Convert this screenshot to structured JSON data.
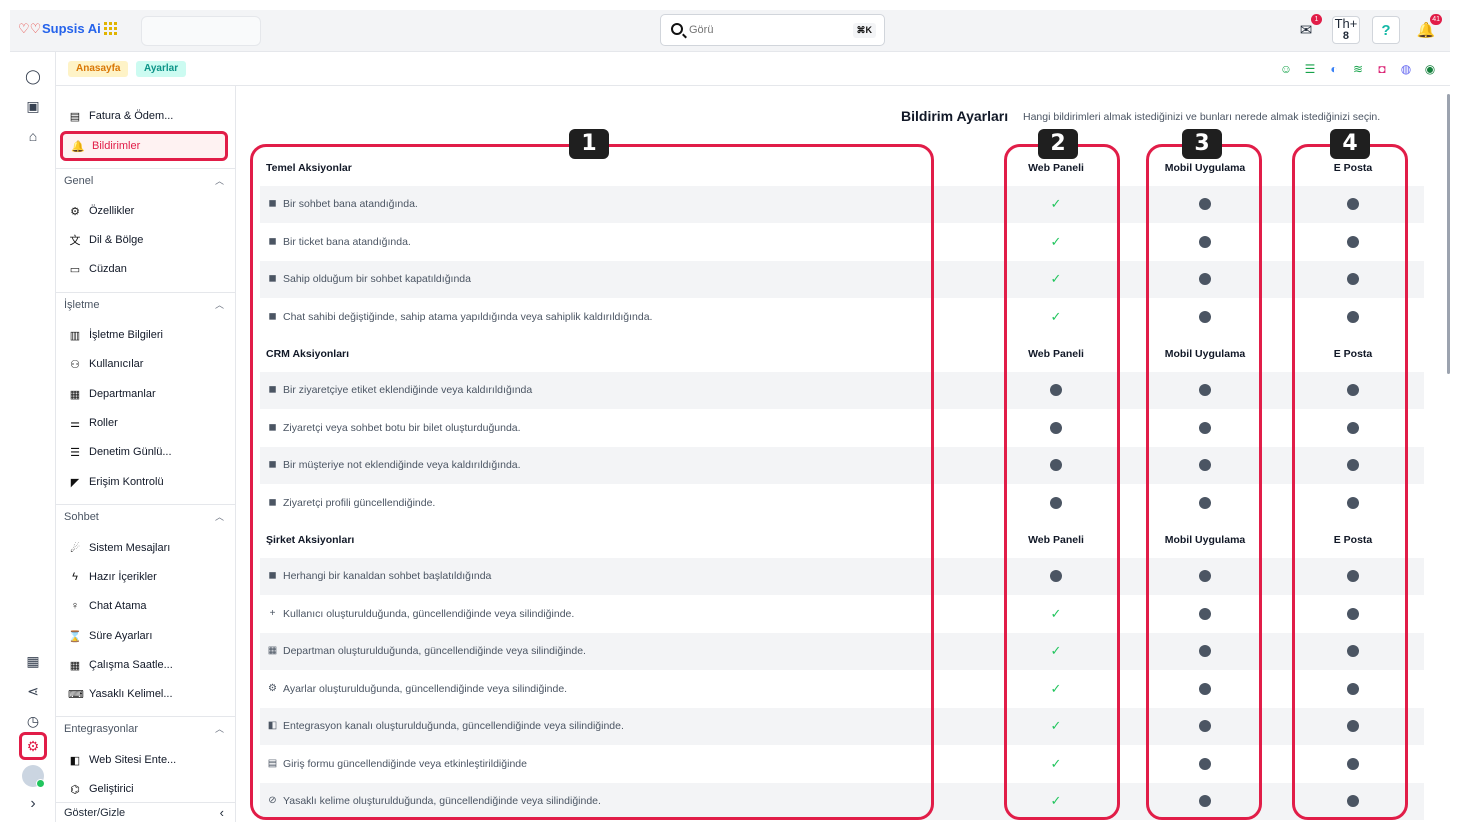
{
  "app": {
    "name": "Supsis Ai"
  },
  "search": {
    "placeholder": "Görü",
    "shortcut": "⌘K"
  },
  "top_icons": [
    {
      "icon": "mail-icon",
      "badge": "1"
    },
    {
      "icon": "workspace-icon",
      "label": "Th",
      "sub": "8"
    },
    {
      "icon": "help-icon"
    },
    {
      "icon": "bell-icon",
      "badge": "41"
    }
  ],
  "breadcrumb": {
    "home": "Anasayfa",
    "current": "Ayarlar"
  },
  "sidebar": {
    "top_items": [
      {
        "label": "Fatura & Ödem...",
        "icon": "billing-icon"
      },
      {
        "label": "Bildirimler",
        "icon": "bell-icon"
      }
    ],
    "sections": [
      {
        "title": "Genel",
        "items": [
          "Özellikler",
          "Dil & Bölge",
          "Cüzdan"
        ]
      },
      {
        "title": "İşletme",
        "items": [
          "İşletme Bilgileri",
          "Kullanıcılar",
          "Departmanlar",
          "Roller",
          "Denetim Günlü...",
          "Erişim Kontrolü"
        ]
      },
      {
        "title": "Sohbet",
        "items": [
          "Sistem Mesajları",
          "Hazır İçerikler",
          "Chat Atama",
          "Süre Ayarları",
          "Çalışma Saatle...",
          "Yasaklı Kelimel..."
        ]
      },
      {
        "title": "Entegrasyonlar",
        "items": [
          "Web Sitesi Ente...",
          "Geliştirici"
        ]
      }
    ],
    "footer": "Göster/Gizle"
  },
  "page": {
    "title": "Bildirim Ayarları",
    "description": "Hangi bildirimleri almak istediğinizi ve bunları nerede almak istediğinizi seçin."
  },
  "columns": {
    "web": "Web Paneli",
    "mobile": "Mobil Uygulama",
    "email": "E Posta"
  },
  "groups": [
    {
      "title": "Temel Aksiyonlar",
      "rows": [
        {
          "text": "Bir sohbet bana atandığında.",
          "web": true,
          "mobile": false,
          "email": false
        },
        {
          "text": "Bir ticket bana atandığında.",
          "web": true,
          "mobile": false,
          "email": false
        },
        {
          "text": "Sahip olduğum bir sohbet kapatıldığında",
          "web": true,
          "mobile": false,
          "email": false
        },
        {
          "text": "Chat sahibi değiştiğinde, sahip atama yapıldığında veya sahiplik kaldırıldığında.",
          "web": true,
          "mobile": false,
          "email": false
        }
      ]
    },
    {
      "title": "CRM Aksiyonları",
      "rows": [
        {
          "text": "Bir ziyaretçiye etiket eklendiğinde veya kaldırıldığında",
          "web": false,
          "mobile": false,
          "email": false
        },
        {
          "text": "Ziyaretçi veya sohbet botu bir bilet oluşturduğunda.",
          "web": false,
          "mobile": false,
          "email": false
        },
        {
          "text": "Bir müşteriye not eklendiğinde veya kaldırıldığında.",
          "web": false,
          "mobile": false,
          "email": false
        },
        {
          "text": "Ziyaretçi profili güncellendiğinde.",
          "web": false,
          "mobile": false,
          "email": false
        }
      ]
    },
    {
      "title": "Şirket Aksiyonları",
      "rows": [
        {
          "text": "Herhangi bir kanaldan sohbet başlatıldığında",
          "web": false,
          "mobile": false,
          "email": false
        },
        {
          "text": "Kullanıcı oluşturulduğunda, güncellendiğinde veya silindiğinde.",
          "web": true,
          "mobile": false,
          "email": false
        },
        {
          "text": "Departman oluşturulduğunda, güncellendiğinde veya silindiğinde.",
          "web": true,
          "mobile": false,
          "email": false
        },
        {
          "text": "Ayarlar oluşturulduğunda, güncellendiğinde veya silindiğinde.",
          "web": true,
          "mobile": false,
          "email": false
        },
        {
          "text": "Entegrasyon kanalı oluşturulduğunda, güncellendiğinde veya silindiğinde.",
          "web": true,
          "mobile": false,
          "email": false
        },
        {
          "text": "Giriş formu güncellendiğinde veya etkinleştirildiğinde",
          "web": true,
          "mobile": false,
          "email": false
        },
        {
          "text": "Yasaklı kelime oluşturulduğunda, güncellendiğinde veya silindiğinde.",
          "web": true,
          "mobile": false,
          "email": false
        }
      ]
    }
  ],
  "annotations": [
    "1",
    "2",
    "3",
    "4"
  ],
  "colors": {
    "accent": "#e11d48",
    "check": "#22c55e",
    "dot": "#4b5563",
    "brand": "#2563eb"
  }
}
